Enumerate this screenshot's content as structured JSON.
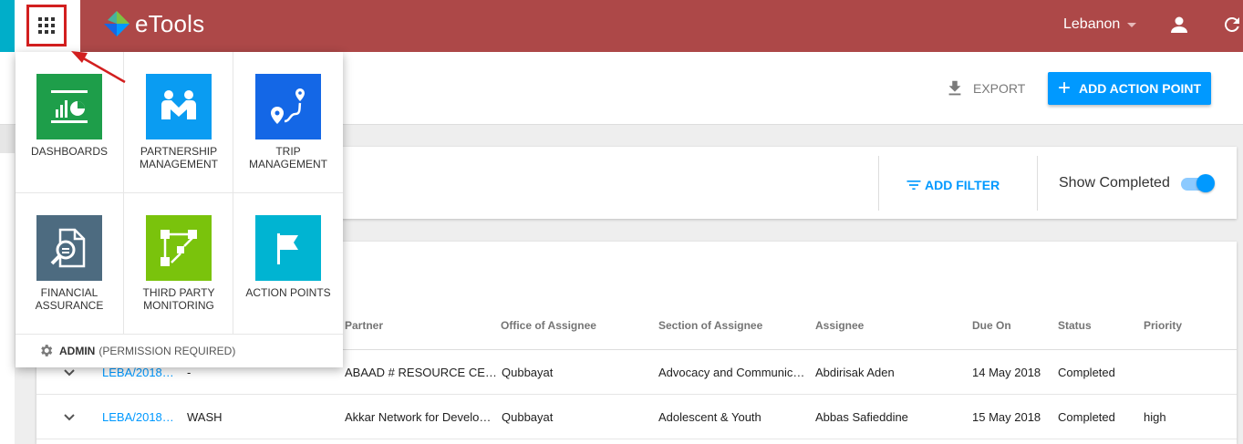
{
  "header": {
    "app_name": "eTools",
    "country": "Lebanon",
    "colors": {
      "header": "#ad4848",
      "accent": "#0099ff",
      "highlight": "#d21f1f"
    }
  },
  "page_actions": {
    "export_label": "EXPORT",
    "add_label": "ADD ACTION POINT"
  },
  "filters": {
    "add_filter_label": "ADD FILTER",
    "show_completed_label": "Show Completed",
    "show_completed": true
  },
  "table": {
    "columns": [
      "Partner",
      "Office of Assignee",
      "Section of Assignee",
      "Assignee",
      "Due On",
      "Status",
      "Priority"
    ],
    "rows": [
      {
        "reference": "LEBA/2018…",
        "sector": "-",
        "partner": "ABAAD # RESOURCE CE…",
        "office": "Qubbayat",
        "section": "Advocacy and Communic…",
        "assignee": "Abdirisak Aden",
        "due_on": "14 May 2018",
        "status": "Completed",
        "priority": ""
      },
      {
        "reference": "LEBA/2018…",
        "sector": "WASH",
        "partner": "Akkar Network for Develo…",
        "office": "Qubbayat",
        "section": "Adolescent & Youth",
        "assignee": "Abbas Safieddine",
        "due_on": "15 May 2018",
        "status": "Completed",
        "priority": "high"
      }
    ]
  },
  "app_menu": {
    "tiles": [
      {
        "label": "DASHBOARDS",
        "icon": "dashboard-chart-icon",
        "color": "#1e9e4a"
      },
      {
        "label": "PARTNERSHIP MANAGEMENT",
        "icon": "handshake-icon",
        "color": "#0a9cf2"
      },
      {
        "label": "TRIP MANAGEMENT",
        "icon": "map-route-icon",
        "color": "#1467e6"
      },
      {
        "label": "FINANCIAL ASSURANCE",
        "icon": "document-search-icon",
        "color": "#4d6b80"
      },
      {
        "label": "THIRD PARTY MONITORING",
        "icon": "workflow-icon",
        "color": "#7ac30c"
      },
      {
        "label": "ACTION POINTS",
        "icon": "flag-icon",
        "color": "#00b4d2"
      }
    ],
    "admin_label": "ADMIN",
    "admin_note": "(PERMISSION REQUIRED)"
  }
}
